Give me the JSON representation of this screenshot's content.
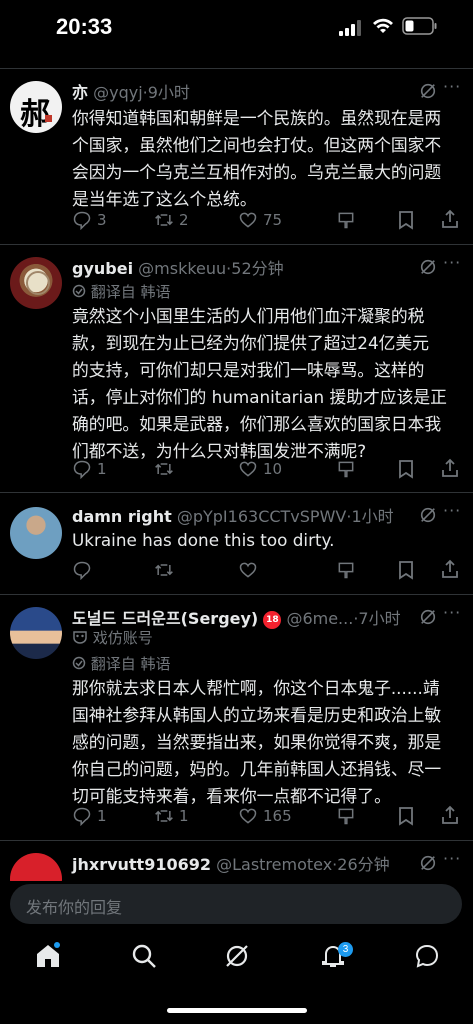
{
  "status_bar": {
    "time": "20:33"
  },
  "tweets": [
    {
      "name": "亦",
      "handle": "@yqyj",
      "time": "9小时",
      "avatar_char": "郝",
      "body": [
        "你得知道韩国和朝鲜是一个民族的。虽然现在是两",
        "个国家，虽然他们之间也会打仗。但这两个国家不",
        "会因为一个乌克兰互相作对的。乌克兰最大的问题",
        "是当年选了这么个总统。"
      ],
      "replies": "3",
      "retweets": "2",
      "likes": "75"
    },
    {
      "name": "gyubei",
      "handle": "@mskkeuu",
      "time": "52分钟",
      "translate": "翻译自 韩语",
      "body": [
        "竟然这个小国里生活的人们用他们血汗凝聚的税",
        "款，到现在为止已经为你们提供了超过24亿美元",
        "的支持，可你们却只是对我们一味辱骂。这样的",
        "话，停止对你们的 humanitarian 援助才应该是正",
        "确的吧。如果是武器，你们那么喜欢的国家日本我",
        "们都不送，为什么只对韩国发泄不满呢?"
      ],
      "replies": "1",
      "retweets": "",
      "likes": "10"
    },
    {
      "name": "damn right",
      "handle": "@pYpI163CCTvSPWV",
      "time": "1小时",
      "body": [
        "Ukraine has done this too dirty."
      ],
      "replies": "",
      "retweets": "",
      "likes": ""
    },
    {
      "name": "도널드 드러운프(Sergey)",
      "handle": "@6me...",
      "time": "7小时",
      "parody": "戏仿账号",
      "translate": "翻译自 韩语",
      "body": [
        "那你就去求日本人帮忙啊，你这个日本鬼子......靖",
        "国神社参拜从韩国人的立场来看是历史和政治上敏",
        "感的问题，当然要指出来，如果你觉得不爽，那是",
        "你自己的问题，妈的。几年前韩国人还捐钱、尽一",
        "切可能支持来着，看来你一点都不记得了。"
      ],
      "replies": "1",
      "retweets": "1",
      "likes": "165"
    },
    {
      "name": "jhxrvutt910692",
      "handle": "@Lastremotex",
      "time": "26分钟"
    }
  ],
  "reply_input": {
    "placeholder": "发布你的回复"
  },
  "nav": {
    "notification_count": "3"
  },
  "colors": {
    "accent": "#1d9bf0",
    "muted": "#71767b",
    "text": "#e7e9ea",
    "badge18": "#f4212e"
  }
}
